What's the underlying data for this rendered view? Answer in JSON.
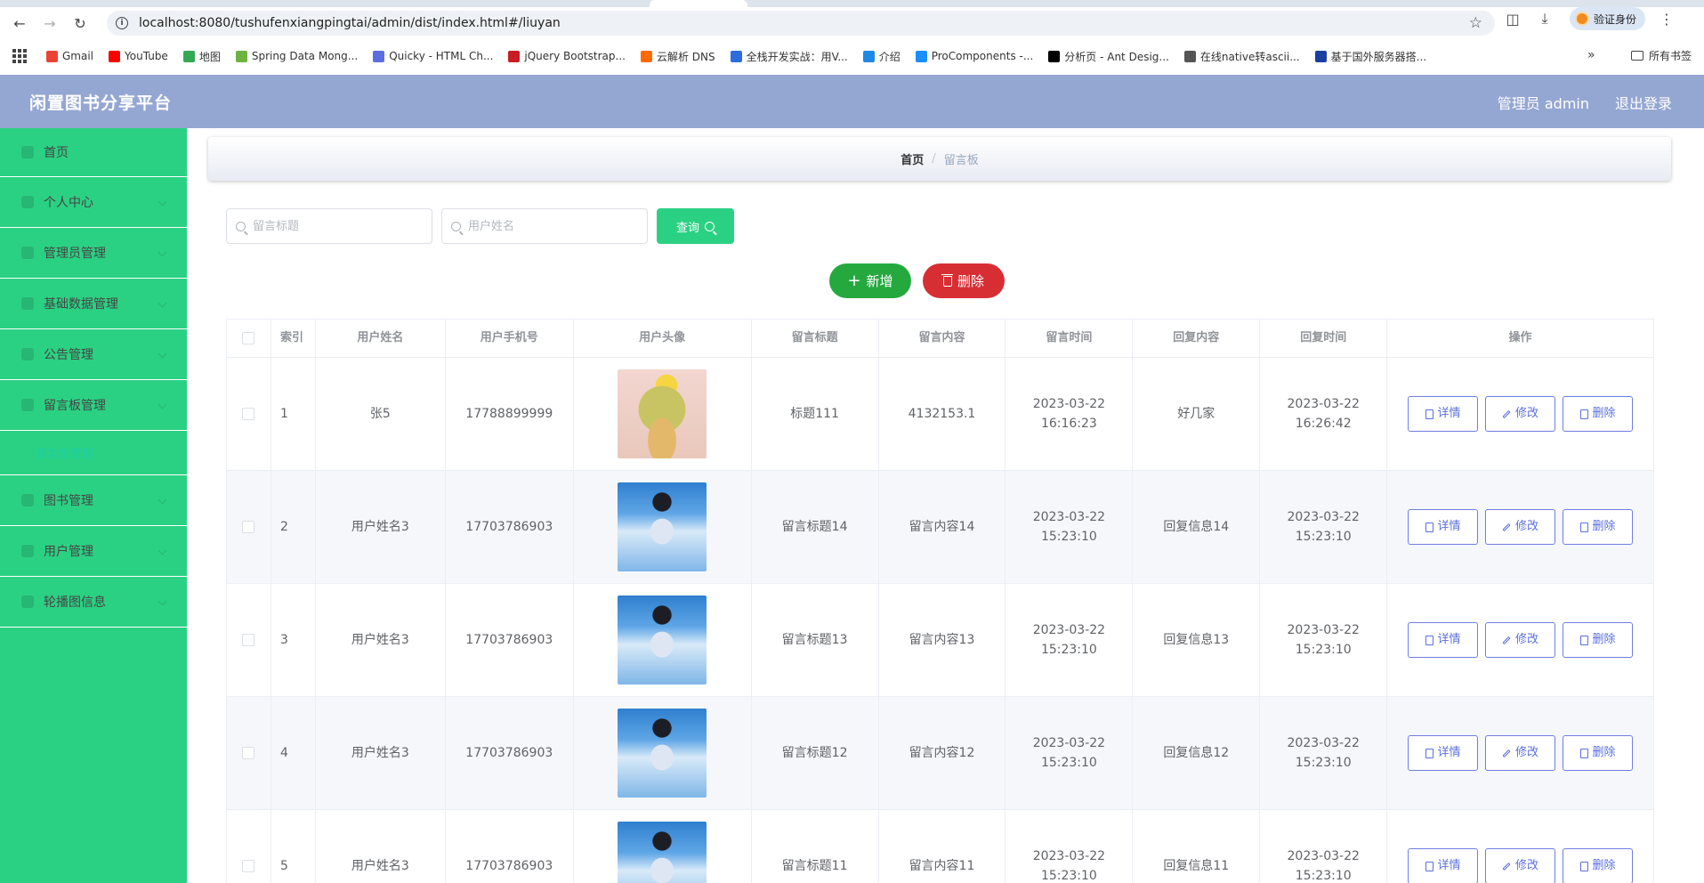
{
  "browser": {
    "url": "localhost:8080/tushufenxiangpingtai/admin/dist/index.html#/liuyan",
    "verify_label": "验证身份",
    "bookmarks": [
      {
        "label": "Gmail",
        "color": "#ea4335"
      },
      {
        "label": "YouTube",
        "color": "#ff0000"
      },
      {
        "label": "地图",
        "color": "#34a853"
      },
      {
        "label": "Spring Data Mong...",
        "color": "#6db33f"
      },
      {
        "label": "Quicky - HTML Ch...",
        "color": "#5b6ee1"
      },
      {
        "label": "jQuery Bootstrap...",
        "color": "#c71d23"
      },
      {
        "label": "云解析 DNS",
        "color": "#ff6a00"
      },
      {
        "label": "全栈开发实战：用V...",
        "color": "#2d6cdf"
      },
      {
        "label": "介绍",
        "color": "#1e88e5"
      },
      {
        "label": "ProComponents -...",
        "color": "#1890ff"
      },
      {
        "label": "分析页 - Ant Desig...",
        "color": "#000000"
      },
      {
        "label": "在线native转ascii...",
        "color": "#555555"
      },
      {
        "label": "基于国外服务器搭...",
        "color": "#1a3fa0"
      }
    ],
    "all_bookmarks": "所有书签"
  },
  "header": {
    "title": "闲置图书分享平台",
    "user": "管理员 admin",
    "logout": "退出登录"
  },
  "sidebar": {
    "items": [
      {
        "label": "首页",
        "has_children": false
      },
      {
        "label": "个人中心",
        "has_children": true
      },
      {
        "label": "管理员管理",
        "has_children": true
      },
      {
        "label": "基础数据管理",
        "has_children": true
      },
      {
        "label": "公告管理",
        "has_children": true
      },
      {
        "label": "留言板管理",
        "has_children": true,
        "sub": "留言板管理"
      },
      {
        "label": "图书管理",
        "has_children": true
      },
      {
        "label": "用户管理",
        "has_children": true
      },
      {
        "label": "轮播图信息",
        "has_children": true
      }
    ]
  },
  "breadcrumb": {
    "home": "首页",
    "current": "留言板"
  },
  "search": {
    "title_placeholder": "留言标题",
    "name_placeholder": "用户姓名",
    "query_label": "查询"
  },
  "actions": {
    "add_label": "新增",
    "delete_label": "删除"
  },
  "table": {
    "columns": [
      "索引",
      "用户姓名",
      "用户手机号",
      "用户头像",
      "留言标题",
      "留言内容",
      "留言时间",
      "回复内容",
      "回复时间",
      "操作"
    ],
    "op_labels": {
      "detail": "详情",
      "edit": "修改",
      "delete": "删除"
    },
    "rows": [
      {
        "index": "1",
        "name": "张5",
        "phone": "17788899999",
        "avatar": "girl",
        "title": "标题111",
        "content": "4132153.1",
        "time": "2023-03-22 16:16:23",
        "reply": "好几家",
        "reply_time": "2023-03-22 16:26:42"
      },
      {
        "index": "2",
        "name": "用户姓名3",
        "phone": "17703786903",
        "avatar": "boy",
        "title": "留言标题14",
        "content": "留言内容14",
        "time": "2023-03-22 15:23:10",
        "reply": "回复信息14",
        "reply_time": "2023-03-22 15:23:10"
      },
      {
        "index": "3",
        "name": "用户姓名3",
        "phone": "17703786903",
        "avatar": "boy",
        "title": "留言标题13",
        "content": "留言内容13",
        "time": "2023-03-22 15:23:10",
        "reply": "回复信息13",
        "reply_time": "2023-03-22 15:23:10"
      },
      {
        "index": "4",
        "name": "用户姓名3",
        "phone": "17703786903",
        "avatar": "boy",
        "title": "留言标题12",
        "content": "留言内容12",
        "time": "2023-03-22 15:23:10",
        "reply": "回复信息12",
        "reply_time": "2023-03-22 15:23:10"
      },
      {
        "index": "5",
        "name": "用户姓名3",
        "phone": "17703786903",
        "avatar": "boy",
        "title": "留言标题11",
        "content": "留言内容11",
        "time": "2023-03-22 15:23:10",
        "reply": "回复信息11",
        "reply_time": "2023-03-22 15:23:10"
      }
    ]
  }
}
